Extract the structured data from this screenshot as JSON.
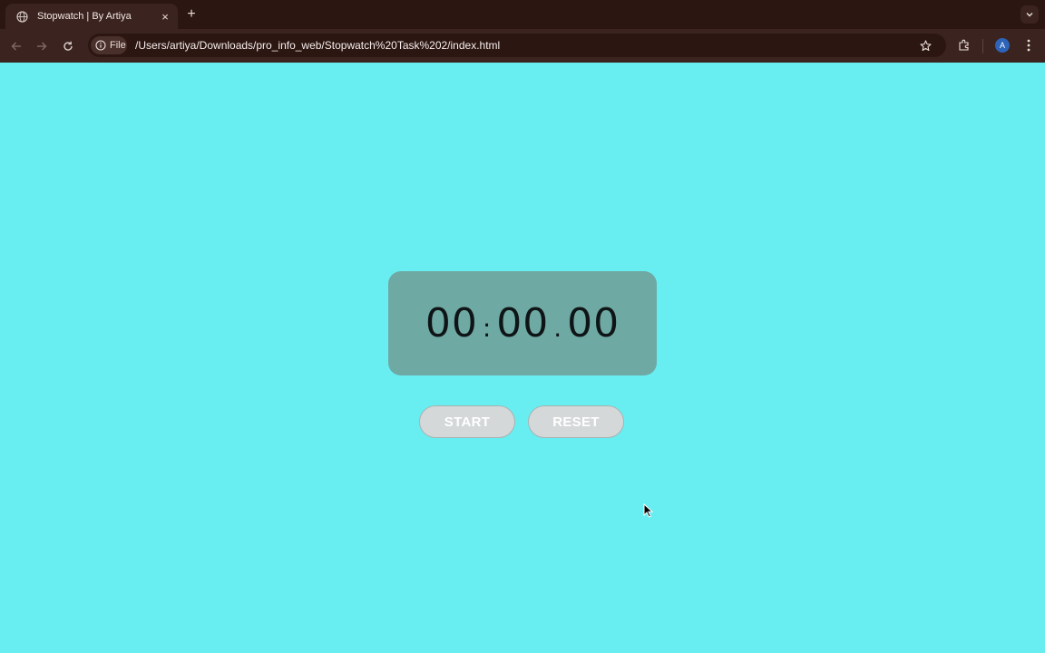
{
  "browser": {
    "tab_title": "Stopwatch | By Artiya",
    "tab_close": "×",
    "new_tab": "+",
    "site_chip": "File",
    "url": "/Users/artiya/Downloads/pro_info_web/Stopwatch%20Task%202/index.html",
    "profile_initial": "A"
  },
  "stopwatch": {
    "minutes": "00",
    "sep1": ":",
    "seconds": "00",
    "sep2": ".",
    "centiseconds": "00",
    "start_label": "START",
    "reset_label": "RESET"
  },
  "colors": {
    "page_background": "#68EEF1",
    "timer_box": "#6FA9A4",
    "button_background": "#D4D8D8",
    "chrome_dark": "#2B1612",
    "chrome_toolbar": "#3B2420"
  }
}
